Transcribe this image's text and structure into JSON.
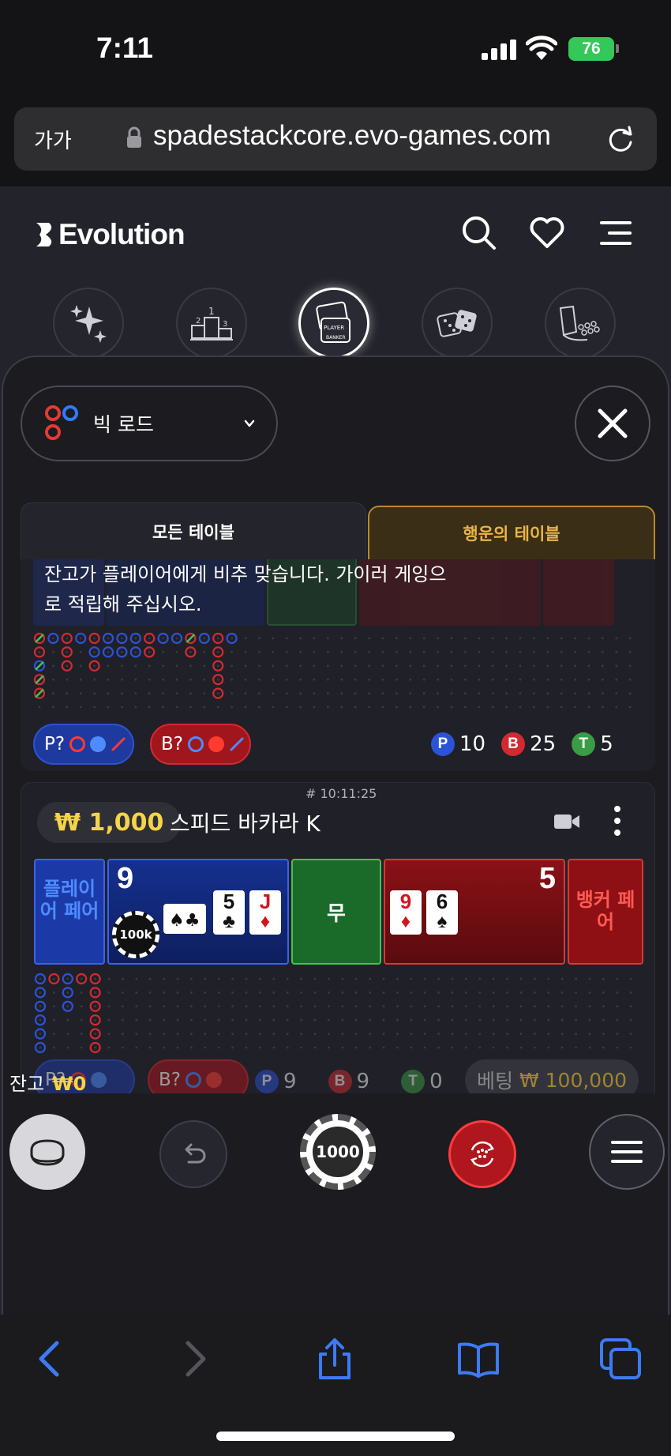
{
  "status_bar": {
    "time": "7:11",
    "battery": "76"
  },
  "browser": {
    "text_size_label": "가가",
    "url": "spadestackcore.evo-games.com"
  },
  "app": {
    "logo": "Evolution",
    "categories": [
      "sparkle-icon",
      "podium-icon",
      "baccarat-icon",
      "dice-icon",
      "roulette-icon"
    ]
  },
  "lobby": {
    "road_type": "빅 로드",
    "tabs": {
      "all": "모든 테이블",
      "lucky": "행운의 테이블"
    },
    "toast": [
      "잔고가 플레이어에게 비추 맞습니다. 가이러 게잉으",
      "로 적립해 주십시오."
    ],
    "table1": {
      "player_prediction": "P?",
      "banker_prediction": "B?",
      "stats": {
        "p_label": "P",
        "p": "10",
        "b_label": "B",
        "b": "25",
        "t_label": "T",
        "t": "5"
      }
    },
    "table2": {
      "id": "# 10:11:25",
      "stake": "₩ 1,000",
      "name": "스피드 바카라 K",
      "player_pair": "플레이어 페어",
      "player_score": "9",
      "chip_label": "100k",
      "tie": "무",
      "banker_score": "5",
      "banker_pair": "뱅커 페어",
      "player_cards": [
        {
          "rank": "5",
          "suit": "♣",
          "red": false
        },
        {
          "rank": "J",
          "suit": "♦",
          "red": true
        }
      ],
      "banker_cards": [
        {
          "rank": "9",
          "suit": "♦",
          "red": true
        },
        {
          "rank": "6",
          "suit": "♠",
          "red": false
        }
      ],
      "player_prediction": "P?",
      "banker_prediction": "B?",
      "stats": {
        "p_label": "P",
        "p": "9",
        "b_label": "B",
        "b": "9",
        "t_label": "T",
        "t": "0"
      },
      "bet_label": "베팅",
      "bet_value": "₩ 100,000"
    }
  },
  "controls": {
    "chip_value": "1000",
    "balance_label": "잔고",
    "balance_value": "₩0"
  },
  "colors": {
    "player": "#2b53d8",
    "banker": "#d32a31",
    "tie": "#47c151",
    "gold": "#f5d44a"
  }
}
